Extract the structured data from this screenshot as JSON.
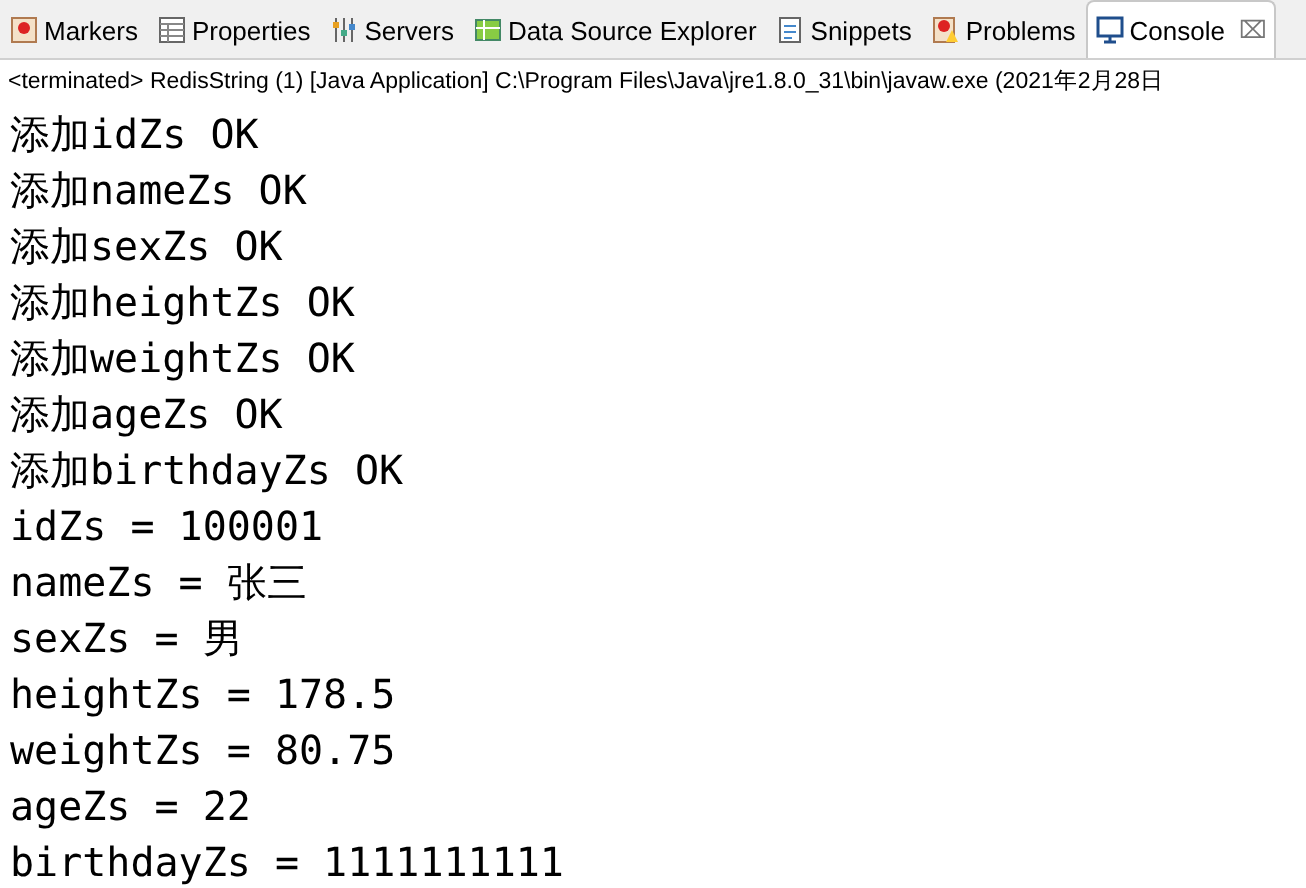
{
  "tabs": [
    {
      "label": "Markers",
      "kind": "markers",
      "selected": false
    },
    {
      "label": "Properties",
      "kind": "properties",
      "selected": false
    },
    {
      "label": "Servers",
      "kind": "servers",
      "selected": false
    },
    {
      "label": "Data Source Explorer",
      "kind": "datasource",
      "selected": false
    },
    {
      "label": "Snippets",
      "kind": "snippets",
      "selected": false
    },
    {
      "label": "Problems",
      "kind": "problems",
      "selected": false
    },
    {
      "label": "Console",
      "kind": "console",
      "selected": true,
      "close": "⌧"
    }
  ],
  "console": {
    "header": "<terminated> RedisString (1) [Java Application] C:\\Program Files\\Java\\jre1.8.0_31\\bin\\javaw.exe (2021年2月28日",
    "lines": [
      "添加idZs OK",
      "添加nameZs OK",
      "添加sexZs OK",
      "添加heightZs OK",
      "添加weightZs OK",
      "添加ageZs OK",
      "添加birthdayZs OK",
      "idZs = 100001",
      "nameZs = 张三",
      "sexZs = 男",
      "heightZs = 178.5",
      "weightZs = 80.75",
      "ageZs = 22",
      "birthdayZs = 1111111111"
    ]
  }
}
